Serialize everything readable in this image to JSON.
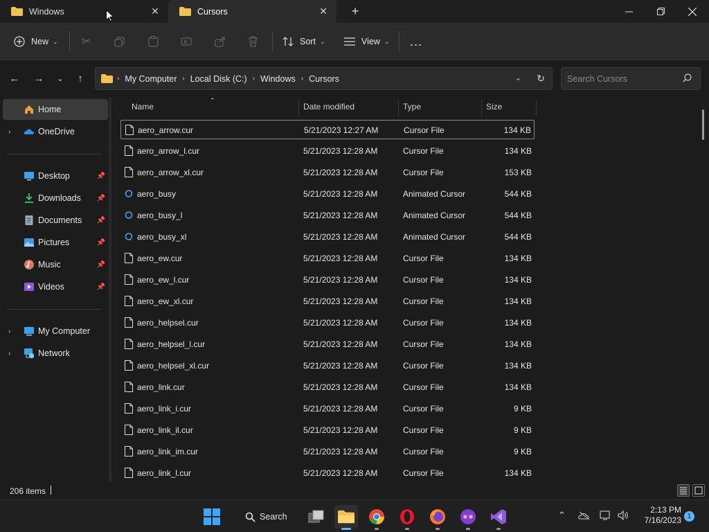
{
  "tabs": [
    {
      "label": "Windows",
      "active": false
    },
    {
      "label": "Cursors",
      "active": true
    }
  ],
  "toolbar": {
    "new_label": "New",
    "sort_label": "Sort",
    "view_label": "View",
    "more_label": "..."
  },
  "address": {
    "crumbs": [
      "My Computer",
      "Local Disk (C:)",
      "Windows",
      "Cursors"
    ]
  },
  "search": {
    "placeholder": "Search Cursors"
  },
  "sidebar": {
    "items": [
      {
        "label": "Home"
      },
      {
        "label": "OneDrive"
      },
      {
        "label": "Desktop"
      },
      {
        "label": "Downloads"
      },
      {
        "label": "Documents"
      },
      {
        "label": "Pictures"
      },
      {
        "label": "Music"
      },
      {
        "label": "Videos"
      },
      {
        "label": "My Computer"
      },
      {
        "label": "Network"
      }
    ]
  },
  "columns": {
    "name": "Name",
    "date": "Date modified",
    "type": "Type",
    "size": "Size"
  },
  "files": [
    {
      "name": "aero_arrow.cur",
      "date": "5/21/2023 12:27 AM",
      "type": "Cursor File",
      "size": "134 KB"
    },
    {
      "name": "aero_arrow_l.cur",
      "date": "5/21/2023 12:28 AM",
      "type": "Cursor File",
      "size": "134 KB"
    },
    {
      "name": "aero_arrow_xl.cur",
      "date": "5/21/2023 12:28 AM",
      "type": "Cursor File",
      "size": "153 KB"
    },
    {
      "name": "aero_busy",
      "date": "5/21/2023 12:28 AM",
      "type": "Animated Cursor",
      "size": "544 KB"
    },
    {
      "name": "aero_busy_l",
      "date": "5/21/2023 12:28 AM",
      "type": "Animated Cursor",
      "size": "544 KB"
    },
    {
      "name": "aero_busy_xl",
      "date": "5/21/2023 12:28 AM",
      "type": "Animated Cursor",
      "size": "544 KB"
    },
    {
      "name": "aero_ew.cur",
      "date": "5/21/2023 12:28 AM",
      "type": "Cursor File",
      "size": "134 KB"
    },
    {
      "name": "aero_ew_l.cur",
      "date": "5/21/2023 12:28 AM",
      "type": "Cursor File",
      "size": "134 KB"
    },
    {
      "name": "aero_ew_xl.cur",
      "date": "5/21/2023 12:28 AM",
      "type": "Cursor File",
      "size": "134 KB"
    },
    {
      "name": "aero_helpsel.cur",
      "date": "5/21/2023 12:28 AM",
      "type": "Cursor File",
      "size": "134 KB"
    },
    {
      "name": "aero_helpsel_l.cur",
      "date": "5/21/2023 12:28 AM",
      "type": "Cursor File",
      "size": "134 KB"
    },
    {
      "name": "aero_helpsel_xl.cur",
      "date": "5/21/2023 12:28 AM",
      "type": "Cursor File",
      "size": "134 KB"
    },
    {
      "name": "aero_link.cur",
      "date": "5/21/2023 12:28 AM",
      "type": "Cursor File",
      "size": "134 KB"
    },
    {
      "name": "aero_link_i.cur",
      "date": "5/21/2023 12:28 AM",
      "type": "Cursor File",
      "size": "9 KB"
    },
    {
      "name": "aero_link_il.cur",
      "date": "5/21/2023 12:28 AM",
      "type": "Cursor File",
      "size": "9 KB"
    },
    {
      "name": "aero_link_im.cur",
      "date": "5/21/2023 12:28 AM",
      "type": "Cursor File",
      "size": "9 KB"
    },
    {
      "name": "aero_link_l.cur",
      "date": "5/21/2023 12:28 AM",
      "type": "Cursor File",
      "size": "134 KB"
    }
  ],
  "status": {
    "item_count": "206 items"
  },
  "taskbar": {
    "search_label": "Search",
    "time": "2:13 PM",
    "date": "7/16/2023",
    "notification_count": "1"
  },
  "colors": {
    "accent": "#5ab4ff",
    "folder": "#f2c14e",
    "busy": "#4aa3ff"
  }
}
